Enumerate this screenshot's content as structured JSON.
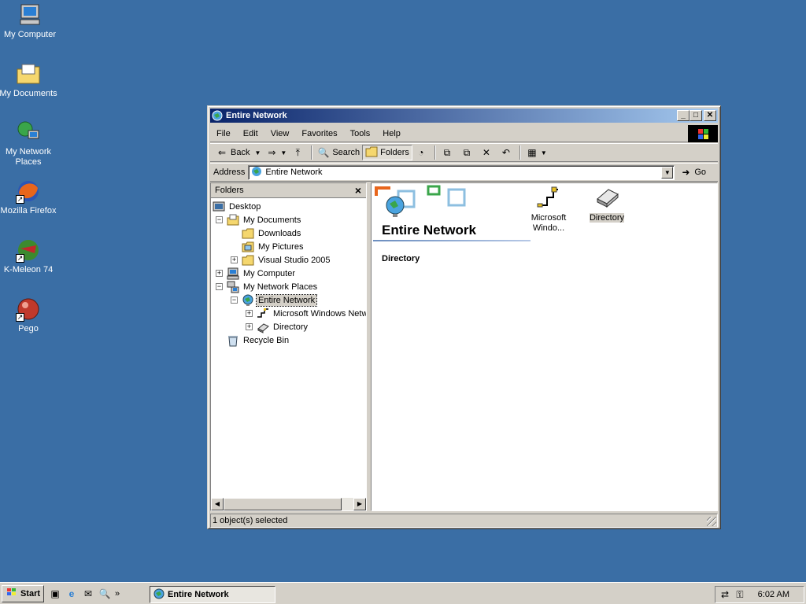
{
  "desktop": {
    "icons": [
      {
        "label": "My Computer",
        "icon": "computer-icon"
      },
      {
        "label": "My Documents",
        "icon": "documents-folder-icon"
      },
      {
        "label": "My Network Places",
        "icon": "network-places-icon"
      },
      {
        "label": "Mozilla Firefox",
        "icon": "firefox-icon"
      },
      {
        "label": "K-Meleon 74",
        "icon": "k-meleon-icon"
      },
      {
        "label": "Pego",
        "icon": "pego-icon"
      }
    ]
  },
  "window": {
    "title": "Entire Network",
    "menu": [
      "File",
      "Edit",
      "View",
      "Favorites",
      "Tools",
      "Help"
    ],
    "toolbar": {
      "back": "Back",
      "search": "Search",
      "folders": "Folders"
    },
    "address": {
      "label": "Address",
      "value": "Entire Network",
      "go": "Go"
    },
    "folders_pane": {
      "title": "Folders",
      "tree": [
        {
          "label": "Desktop"
        },
        {
          "label": "My Documents"
        },
        {
          "label": "Downloads"
        },
        {
          "label": "My Pictures"
        },
        {
          "label": "Visual Studio 2005"
        },
        {
          "label": "My Computer"
        },
        {
          "label": "My Network Places"
        },
        {
          "label": "Entire Network"
        },
        {
          "label": "Microsoft Windows Netw"
        },
        {
          "label": "Directory"
        },
        {
          "label": "Recycle Bin"
        }
      ]
    },
    "content": {
      "banner_title": "Entire Network",
      "section_label": "Directory",
      "items": [
        {
          "label": "Microsoft Windo...",
          "icon": "network-cable-icon"
        },
        {
          "label": "Directory",
          "icon": "directory-icon"
        }
      ]
    },
    "status": "1 object(s) selected"
  },
  "taskbar": {
    "start": "Start",
    "task": "Entire Network",
    "clock": "6:02 AM"
  },
  "colors": {
    "desktop_bg": "#3a6ea5",
    "title_start": "#0a246a",
    "title_end": "#a6caf0",
    "chrome": "#d4d0c8"
  }
}
